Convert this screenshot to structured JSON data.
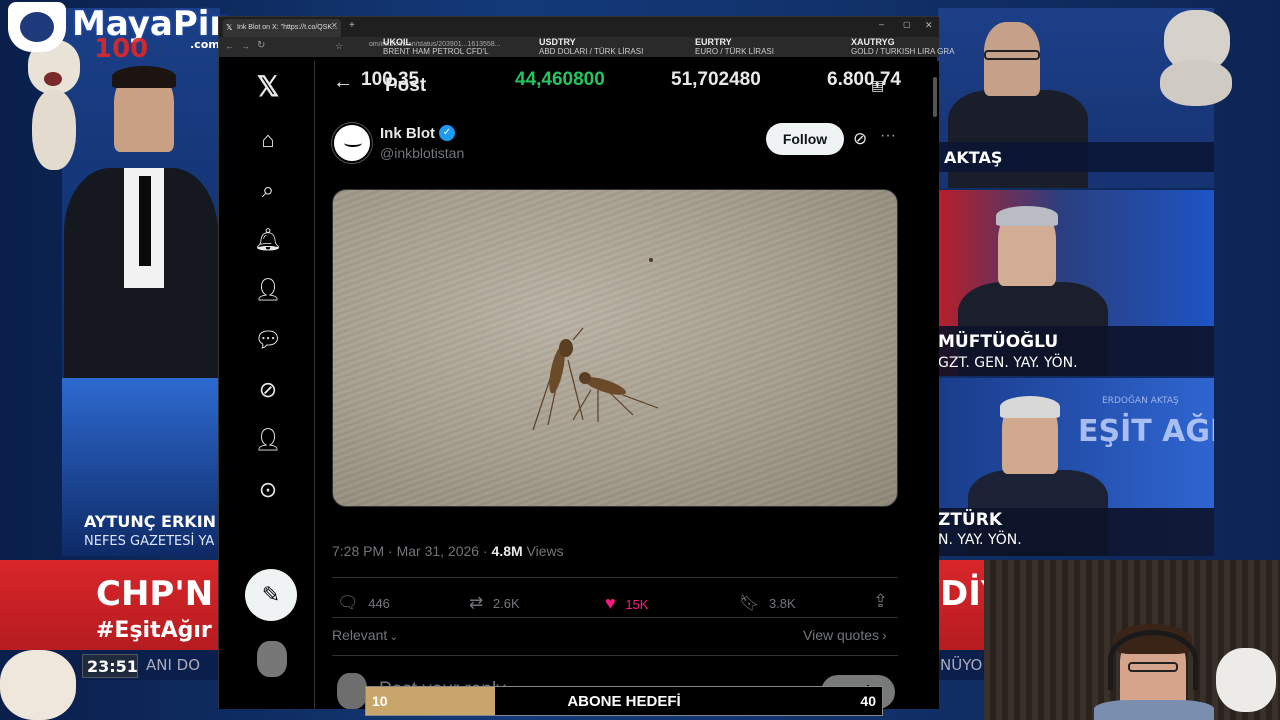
{
  "overlay": {
    "brand": "MayaPin",
    "brand_suffix": ".com",
    "channel": "100"
  },
  "tv": {
    "captions": {
      "left_name": "AYTUNÇ ERKIN",
      "left_org": "NEFES GAZETESİ YA",
      "right_top_name": "AKTAŞ",
      "right_mid_name": "MÜFTÜOĞLU",
      "right_mid_title": "GZT. GEN. YAY. YÖN.",
      "right_bottom_name": "ZTÜRK",
      "right_bottom_title": "N. YAY. YÖN.",
      "right_bottom_bg": "ERDOĞAN AKTAŞ",
      "right_bottom_bg2": "EŞİT AĞIRI",
      "banner_left": "CHP'N",
      "banner_hashtag": "#EşitAğır",
      "banner_right": "DİY",
      "clock": "23:51",
      "clock_tail": "ANI DO",
      "bottom_right_tail": "NÜYO"
    }
  },
  "browser": {
    "tab_title": "Ink Blot on X: \"https://t.co/QSK...",
    "url": "om/inkblotistan/status/203901...1613558...",
    "tickers": [
      {
        "code": "UKOIL",
        "desc": "BRENT HAM PETROL CFD'L"
      },
      {
        "code": "USDTRY",
        "desc": "ABD DOLARI / TÜRK LİRASI"
      },
      {
        "code": "EURTRY",
        "desc": "EURO / TÜRK LİRASI"
      },
      {
        "code": "XAUTRYG",
        "desc": "GOLD / TURKISH LIRA GRA"
      }
    ],
    "prices": [
      "100,35",
      "44,460800",
      "51,702480",
      "6.800,74"
    ],
    "price_colors": [
      "#e7e9ea",
      "#22c55e",
      "#e7e9ea",
      "#e7e9ea"
    ]
  },
  "x": {
    "header_title": "Post",
    "author": {
      "name": "Ink Blot",
      "handle": "@inkblotistan",
      "verified_color": "#1d9bf0"
    },
    "follow_label": "Follow",
    "timestamp": "7:28 PM · Mar 31, 2026 · ",
    "views_count": "4.8M",
    "views_label": " Views",
    "actions": {
      "replies": "446",
      "reposts": "2.6K",
      "likes": "15K",
      "bookmarks": "3.8K"
    },
    "like_color": "#f91880",
    "sort_label": "Relevant",
    "view_quotes": "View quotes",
    "reply_placeholder": "Post your reply",
    "reply_button": "Reply"
  },
  "goal": {
    "title": "ABONE HEDEFİ",
    "current": "10",
    "target": "40",
    "progress": 0.25
  }
}
